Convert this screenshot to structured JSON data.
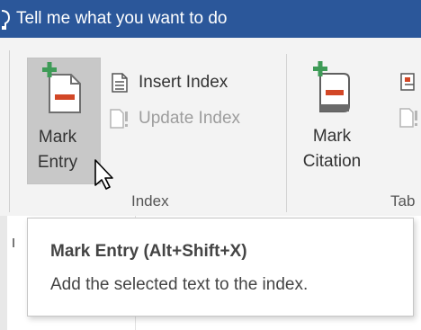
{
  "tell_me": {
    "text": "Tell me what you want to do",
    "icon": "lightbulb-icon"
  },
  "ribbon": {
    "mark_entry": {
      "label_line1": "Mark",
      "label_line2": "Entry",
      "icon": "mark-entry-icon"
    },
    "insert_index": {
      "label": "Insert Index",
      "icon": "document-icon"
    },
    "update_index": {
      "label": "Update Index",
      "icon": "update-index-icon",
      "enabled": false
    },
    "groups": {
      "index": "Index",
      "table_partial": "Tab"
    },
    "mark_citation": {
      "label_line1": "Mark",
      "label_line2": "Citation",
      "icon": "mark-citation-icon"
    }
  },
  "tooltip": {
    "title": "Mark Entry (Alt+Shift+X)",
    "description": "Add the selected text to the index."
  },
  "colors": {
    "title_bar": "#2b579a",
    "ribbon_bg": "#f3f3f3",
    "highlight": "#c8c8c8",
    "icon_green": "#3e9b57",
    "icon_red": "#d24726"
  }
}
